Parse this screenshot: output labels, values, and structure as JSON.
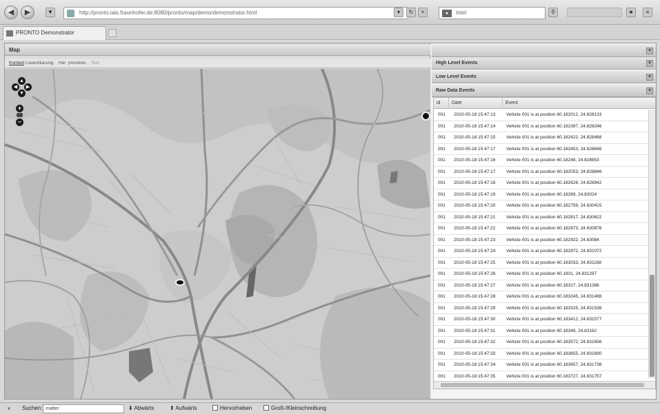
{
  "browser": {
    "url": "http://pronto.iais.fraunhofer.de:8080/pronto/map/demo/demonstrator.html",
    "search_placeholder": "Intel",
    "back_icon": "back-arrow-icon",
    "forward_icon": "forward-arrow-icon"
  },
  "tab": {
    "title": "PRONTO Demonstrator"
  },
  "map_panel": {
    "title": "Map",
    "tabs": [
      "Kontext",
      "Lowestkarung",
      "Her",
      "previews",
      "Text"
    ]
  },
  "right_panel": {
    "sections": [
      "High Level Events",
      "Low Level Events",
      "Raw Data Events"
    ],
    "grid": {
      "columns": [
        "id",
        "Date",
        "Event"
      ],
      "rows": [
        [
          "001",
          "2010-05-18 15:47:13",
          "Vehicle 001 is at position 60.182012, 24.828133"
        ],
        [
          "001",
          "2010-05-18 15:47:14",
          "Vehicle 001 is at position 60.182387, 24.828246"
        ],
        [
          "001",
          "2010-05-18 15:47:15",
          "Vehicle 001 is at position 60.182422, 24.828468"
        ],
        [
          "001",
          "2010-05-18 15:47:17",
          "Vehicle 001 is at position 60.182453, 24.828646"
        ],
        [
          "001",
          "2010-05-18 15:47:16",
          "Vehicle 001 is at position 60.18248, 24.828853"
        ],
        [
          "001",
          "2010-05-18 15:47:17",
          "Vehicle 001 is at position 60.182053, 24.828846"
        ],
        [
          "001",
          "2010-05-18 15:47:18",
          "Vehicle 001 is at position 60.182626, 24.828942"
        ],
        [
          "001",
          "2010-05-18 15:47:19",
          "Vehicle 001 is at position 60.18269, 24.83024"
        ],
        [
          "001",
          "2010-05-18 15:47:20",
          "Vehicle 001 is at position 60.182759, 24.830415"
        ],
        [
          "001",
          "2010-05-18 15:47:21",
          "Vehicle 001 is at position 60.182817, 24.830622"
        ],
        [
          "001",
          "2010-05-18 15:47:22",
          "Vehicle 001 is at position 60.182873, 24.830878"
        ],
        [
          "001",
          "2010-05-18 15:47:23",
          "Vehicle 001 is at position 60.182922, 24.83084"
        ],
        [
          "001",
          "2010-05-18 15:47:24",
          "Vehicle 001 is at position 60.182972, 24.831072"
        ],
        [
          "001",
          "2010-05-18 15:47:25",
          "Vehicle 001 is at position 60.183033, 24.831168"
        ],
        [
          "001",
          "2010-05-18 15:47:26",
          "Vehicle 001 is at position 60.1831, 24.831297"
        ],
        [
          "001",
          "2010-05-18 15:47:27",
          "Vehicle 001 is at position 60.18317, 24.831386"
        ],
        [
          "001",
          "2010-05-18 15:47:28",
          "Vehicle 001 is at position 60.183245, 24.831488"
        ],
        [
          "001",
          "2010-05-18 15:47:29",
          "Vehicle 001 is at position 60.183325, 24.831536"
        ],
        [
          "001",
          "2010-05-18 15:47:30",
          "Vehicle 001 is at position 60.183412, 24.831577"
        ],
        [
          "001",
          "2010-05-18 15:47:31",
          "Vehicle 001 is at position 60.18349, 24.83162"
        ],
        [
          "001",
          "2010-05-18 15:47:32",
          "Vehicle 001 is at position 60.183572, 24.831656"
        ],
        [
          "001",
          "2010-05-18 15:47:33",
          "Vehicle 001 is at position 60.183655, 24.831690"
        ],
        [
          "001",
          "2010-05-18 15:47:34",
          "Vehicle 001 is at position 60.183657, 24.831738"
        ],
        [
          "001",
          "2010-05-18 15:47:35",
          "Vehicle 001 is at position 60.183727, 24.831757"
        ]
      ]
    }
  },
  "findbar": {
    "label": "Suchen:",
    "value": "matter",
    "down": "Abwärts",
    "up": "Aufwärts",
    "highlight": "Hervorheben",
    "match_case": "Groß-/Kleinschreibung"
  }
}
